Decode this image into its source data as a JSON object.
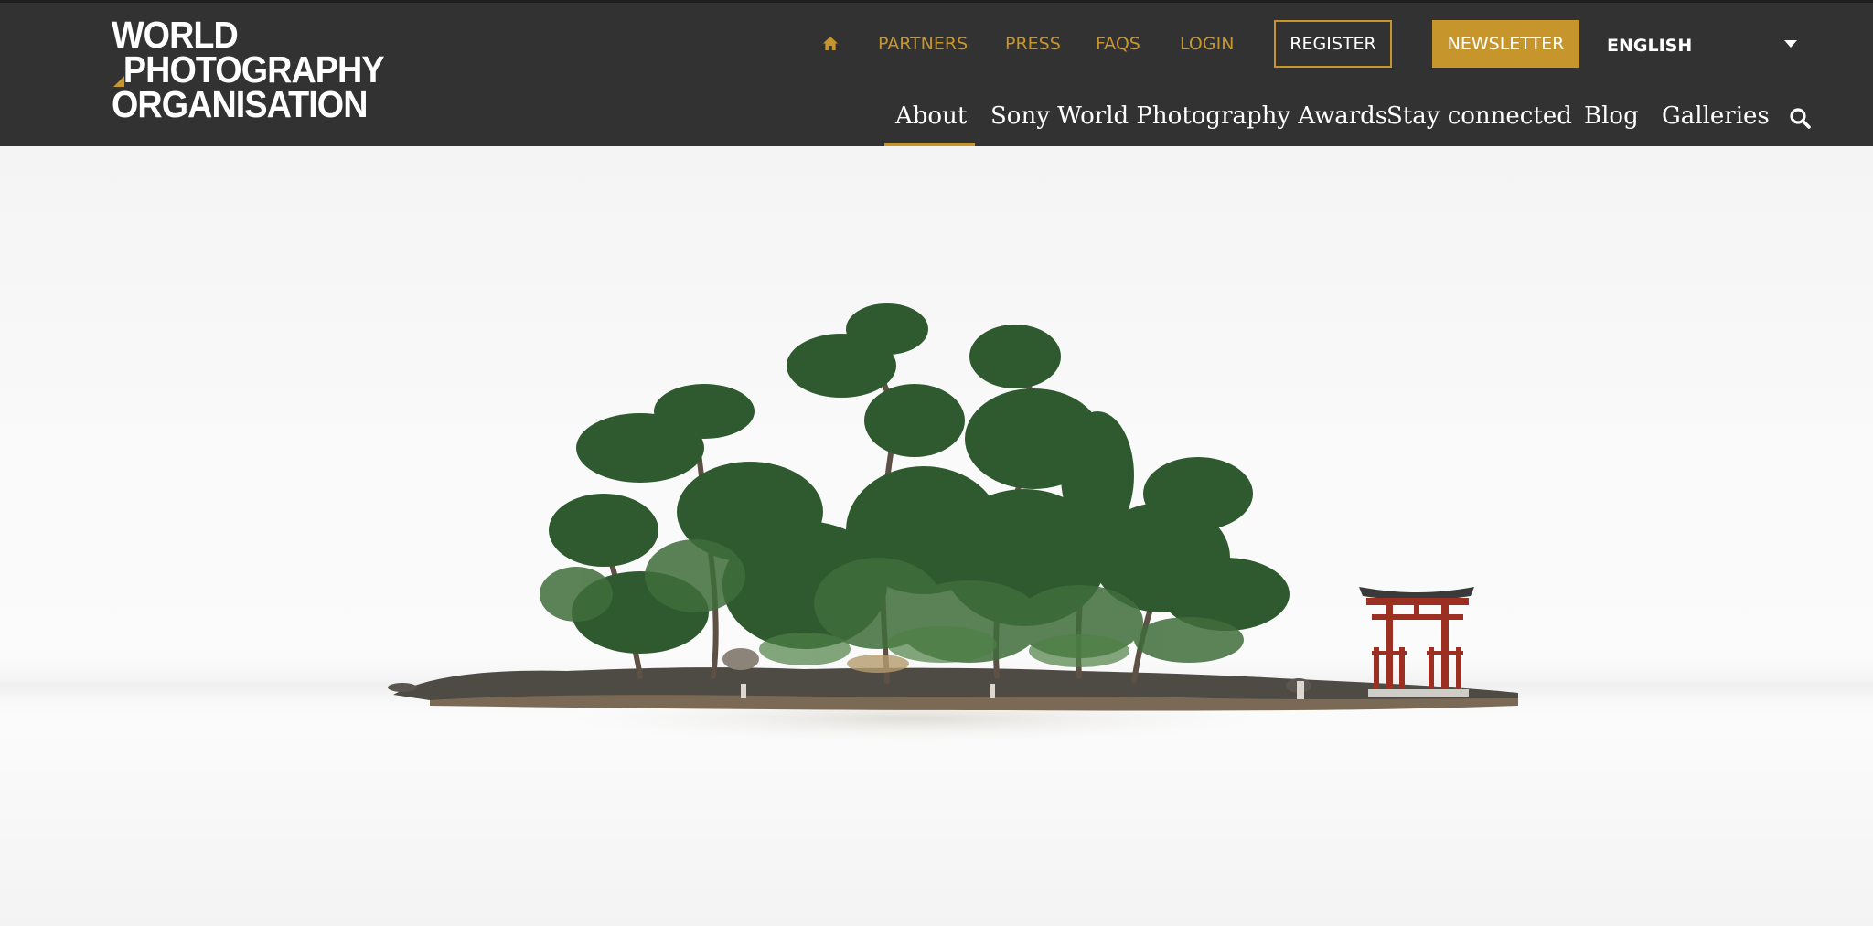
{
  "logo": {
    "line1": "WORLD",
    "line2": "PHOTOGRAPHY",
    "line3": "ORGANISATION",
    "accent_color": "#c6962d"
  },
  "utility_nav": {
    "home_icon": "home-icon",
    "items": [
      {
        "label": "PARTNERS"
      },
      {
        "label": "PRESS"
      },
      {
        "label": "FAQS"
      },
      {
        "label": "LOGIN"
      }
    ],
    "register_label": "REGISTER",
    "newsletter_label": "NEWSLETTER",
    "language": "ENGLISH"
  },
  "main_nav": {
    "items": [
      {
        "label": "About",
        "active": true
      },
      {
        "label": "Sony World Photography Awards"
      },
      {
        "label": "Stay connected"
      },
      {
        "label": "Blog"
      },
      {
        "label": "Galleries"
      }
    ],
    "search_icon": "search-icon"
  },
  "colors": {
    "header_bg": "#323232",
    "accent": "#c6962d",
    "text_light": "#ffffff",
    "torii_red": "#9a2f22"
  },
  "hero": {
    "image": "island-with-pine-trees-and-torii-gate"
  }
}
